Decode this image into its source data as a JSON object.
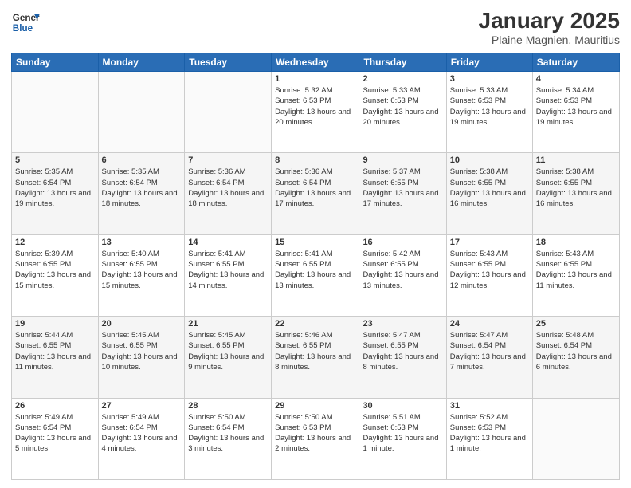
{
  "header": {
    "logo_line1": "General",
    "logo_line2": "Blue",
    "title": "January 2025",
    "subtitle": "Plaine Magnien, Mauritius"
  },
  "weekdays": [
    "Sunday",
    "Monday",
    "Tuesday",
    "Wednesday",
    "Thursday",
    "Friday",
    "Saturday"
  ],
  "weeks": [
    [
      {
        "day": "",
        "info": ""
      },
      {
        "day": "",
        "info": ""
      },
      {
        "day": "",
        "info": ""
      },
      {
        "day": "1",
        "info": "Sunrise: 5:32 AM\nSunset: 6:53 PM\nDaylight: 13 hours and 20 minutes."
      },
      {
        "day": "2",
        "info": "Sunrise: 5:33 AM\nSunset: 6:53 PM\nDaylight: 13 hours and 20 minutes."
      },
      {
        "day": "3",
        "info": "Sunrise: 5:33 AM\nSunset: 6:53 PM\nDaylight: 13 hours and 19 minutes."
      },
      {
        "day": "4",
        "info": "Sunrise: 5:34 AM\nSunset: 6:53 PM\nDaylight: 13 hours and 19 minutes."
      }
    ],
    [
      {
        "day": "5",
        "info": "Sunrise: 5:35 AM\nSunset: 6:54 PM\nDaylight: 13 hours and 19 minutes."
      },
      {
        "day": "6",
        "info": "Sunrise: 5:35 AM\nSunset: 6:54 PM\nDaylight: 13 hours and 18 minutes."
      },
      {
        "day": "7",
        "info": "Sunrise: 5:36 AM\nSunset: 6:54 PM\nDaylight: 13 hours and 18 minutes."
      },
      {
        "day": "8",
        "info": "Sunrise: 5:36 AM\nSunset: 6:54 PM\nDaylight: 13 hours and 17 minutes."
      },
      {
        "day": "9",
        "info": "Sunrise: 5:37 AM\nSunset: 6:55 PM\nDaylight: 13 hours and 17 minutes."
      },
      {
        "day": "10",
        "info": "Sunrise: 5:38 AM\nSunset: 6:55 PM\nDaylight: 13 hours and 16 minutes."
      },
      {
        "day": "11",
        "info": "Sunrise: 5:38 AM\nSunset: 6:55 PM\nDaylight: 13 hours and 16 minutes."
      }
    ],
    [
      {
        "day": "12",
        "info": "Sunrise: 5:39 AM\nSunset: 6:55 PM\nDaylight: 13 hours and 15 minutes."
      },
      {
        "day": "13",
        "info": "Sunrise: 5:40 AM\nSunset: 6:55 PM\nDaylight: 13 hours and 15 minutes."
      },
      {
        "day": "14",
        "info": "Sunrise: 5:41 AM\nSunset: 6:55 PM\nDaylight: 13 hours and 14 minutes."
      },
      {
        "day": "15",
        "info": "Sunrise: 5:41 AM\nSunset: 6:55 PM\nDaylight: 13 hours and 13 minutes."
      },
      {
        "day": "16",
        "info": "Sunrise: 5:42 AM\nSunset: 6:55 PM\nDaylight: 13 hours and 13 minutes."
      },
      {
        "day": "17",
        "info": "Sunrise: 5:43 AM\nSunset: 6:55 PM\nDaylight: 13 hours and 12 minutes."
      },
      {
        "day": "18",
        "info": "Sunrise: 5:43 AM\nSunset: 6:55 PM\nDaylight: 13 hours and 11 minutes."
      }
    ],
    [
      {
        "day": "19",
        "info": "Sunrise: 5:44 AM\nSunset: 6:55 PM\nDaylight: 13 hours and 11 minutes."
      },
      {
        "day": "20",
        "info": "Sunrise: 5:45 AM\nSunset: 6:55 PM\nDaylight: 13 hours and 10 minutes."
      },
      {
        "day": "21",
        "info": "Sunrise: 5:45 AM\nSunset: 6:55 PM\nDaylight: 13 hours and 9 minutes."
      },
      {
        "day": "22",
        "info": "Sunrise: 5:46 AM\nSunset: 6:55 PM\nDaylight: 13 hours and 8 minutes."
      },
      {
        "day": "23",
        "info": "Sunrise: 5:47 AM\nSunset: 6:55 PM\nDaylight: 13 hours and 8 minutes."
      },
      {
        "day": "24",
        "info": "Sunrise: 5:47 AM\nSunset: 6:54 PM\nDaylight: 13 hours and 7 minutes."
      },
      {
        "day": "25",
        "info": "Sunrise: 5:48 AM\nSunset: 6:54 PM\nDaylight: 13 hours and 6 minutes."
      }
    ],
    [
      {
        "day": "26",
        "info": "Sunrise: 5:49 AM\nSunset: 6:54 PM\nDaylight: 13 hours and 5 minutes."
      },
      {
        "day": "27",
        "info": "Sunrise: 5:49 AM\nSunset: 6:54 PM\nDaylight: 13 hours and 4 minutes."
      },
      {
        "day": "28",
        "info": "Sunrise: 5:50 AM\nSunset: 6:54 PM\nDaylight: 13 hours and 3 minutes."
      },
      {
        "day": "29",
        "info": "Sunrise: 5:50 AM\nSunset: 6:53 PM\nDaylight: 13 hours and 2 minutes."
      },
      {
        "day": "30",
        "info": "Sunrise: 5:51 AM\nSunset: 6:53 PM\nDaylight: 13 hours and 1 minute."
      },
      {
        "day": "31",
        "info": "Sunrise: 5:52 AM\nSunset: 6:53 PM\nDaylight: 13 hours and 1 minute."
      },
      {
        "day": "",
        "info": ""
      }
    ]
  ]
}
